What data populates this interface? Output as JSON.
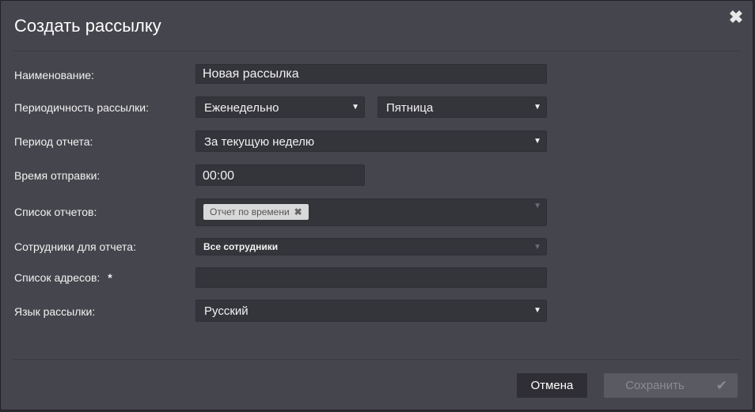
{
  "dialog": {
    "title": "Создать рассылку"
  },
  "labels": {
    "name": "Наименование:",
    "periodicity": "Периодичность рассылки:",
    "report_period": "Период отчета:",
    "send_time": "Время отправки:",
    "report_list": "Список отчетов:",
    "employees": "Сотрудники для отчета:",
    "addresses": "Список адресов:",
    "required_mark": "*",
    "language": "Язык рассылки:"
  },
  "values": {
    "name": "Новая рассылка",
    "periodicity": "Еженедельно",
    "weekday": "Пятница",
    "report_period": "За текущую неделю",
    "send_time": "00:00",
    "report_tag": "Отчет по времени",
    "employees": "Все сотрудники",
    "addresses": "",
    "language": "Русский"
  },
  "icons": {
    "close": "close-icon",
    "dropdown": "chevron-down-icon",
    "remove_tag": "remove-tag-icon",
    "check": "check-icon"
  },
  "buttons": {
    "cancel": "Отмена",
    "save": "Сохранить"
  },
  "colors": {
    "background": "#45454d",
    "field": "#34343b",
    "save_disabled": "#5a5a62",
    "cancel": "#2e2e34"
  }
}
